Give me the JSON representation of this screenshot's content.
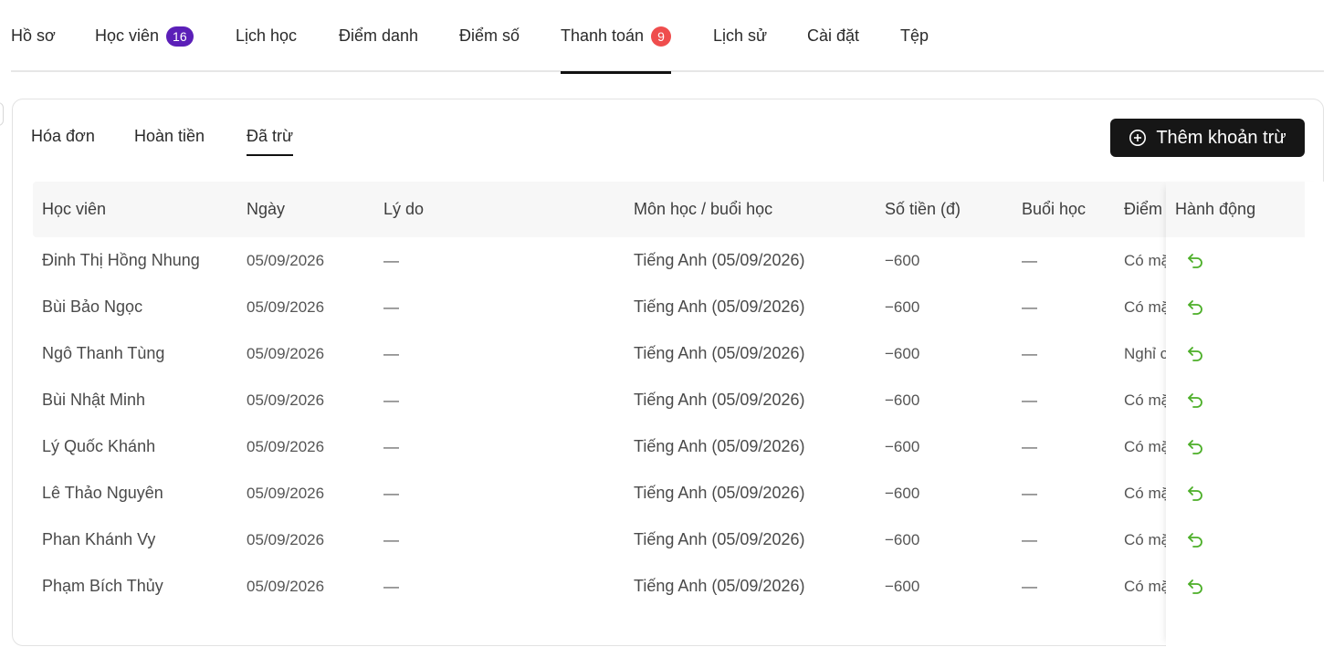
{
  "top_tabs": [
    {
      "label": "Hồ sơ"
    },
    {
      "label": "Học viên",
      "badge": "16"
    },
    {
      "label": "Lịch học"
    },
    {
      "label": "Điểm danh"
    },
    {
      "label": "Điểm số"
    },
    {
      "label": "Thanh toán",
      "badge": "9"
    },
    {
      "label": "Lịch sử"
    },
    {
      "label": "Cài đặt"
    },
    {
      "label": "Tệp"
    }
  ],
  "sub_tabs": [
    "Hóa đơn",
    "Hoàn tiền",
    "Đã trừ"
  ],
  "add_button": "Thêm khoản trừ",
  "columns": [
    "Học viên",
    "Ngày",
    "Lý do",
    "Môn học / buổi học",
    "Số tiền (đ)",
    "Buổi học",
    "Điểm",
    "Hành động"
  ],
  "rows": [
    {
      "student": "Đinh Thị Hồng Nhung",
      "date": "05/09/2026",
      "reason": "—",
      "subject": "Tiếng Anh (05/09/2026)",
      "amount": "−600",
      "session": "—",
      "attendance": "Có mặ"
    },
    {
      "student": "Bùi Bảo Ngọc",
      "date": "05/09/2026",
      "reason": "—",
      "subject": "Tiếng Anh (05/09/2026)",
      "amount": "−600",
      "session": "—",
      "attendance": "Có mặ"
    },
    {
      "student": "Ngô Thanh Tùng",
      "date": "05/09/2026",
      "reason": "—",
      "subject": "Tiếng Anh (05/09/2026)",
      "amount": "−600",
      "session": "—",
      "attendance": "Nghỉ c"
    },
    {
      "student": "Bùi Nhật Minh",
      "date": "05/09/2026",
      "reason": "—",
      "subject": "Tiếng Anh (05/09/2026)",
      "amount": "−600",
      "session": "—",
      "attendance": "Có mặ"
    },
    {
      "student": "Lý Quốc Khánh",
      "date": "05/09/2026",
      "reason": "—",
      "subject": "Tiếng Anh (05/09/2026)",
      "amount": "−600",
      "session": "—",
      "attendance": "Có mặ"
    },
    {
      "student": "Lê Thảo Nguyên",
      "date": "05/09/2026",
      "reason": "—",
      "subject": "Tiếng Anh (05/09/2026)",
      "amount": "−600",
      "session": "—",
      "attendance": "Có mặ"
    },
    {
      "student": "Phan Khánh Vy",
      "date": "05/09/2026",
      "reason": "—",
      "subject": "Tiếng Anh (05/09/2026)",
      "amount": "−600",
      "session": "—",
      "attendance": "Có mặ"
    },
    {
      "student": "Phạm Bích Thủy",
      "date": "05/09/2026",
      "reason": "—",
      "subject": "Tiếng Anh (05/09/2026)",
      "amount": "−600",
      "session": "—",
      "attendance": "Có mặ"
    }
  ],
  "icons": {
    "add": "plus-circle-icon",
    "undo": "undo-icon"
  },
  "colors": {
    "primary": "#161616",
    "badge_purple": "#5b1fb8",
    "badge_red": "#ef4d4d",
    "undo_green": "#4caf28"
  }
}
